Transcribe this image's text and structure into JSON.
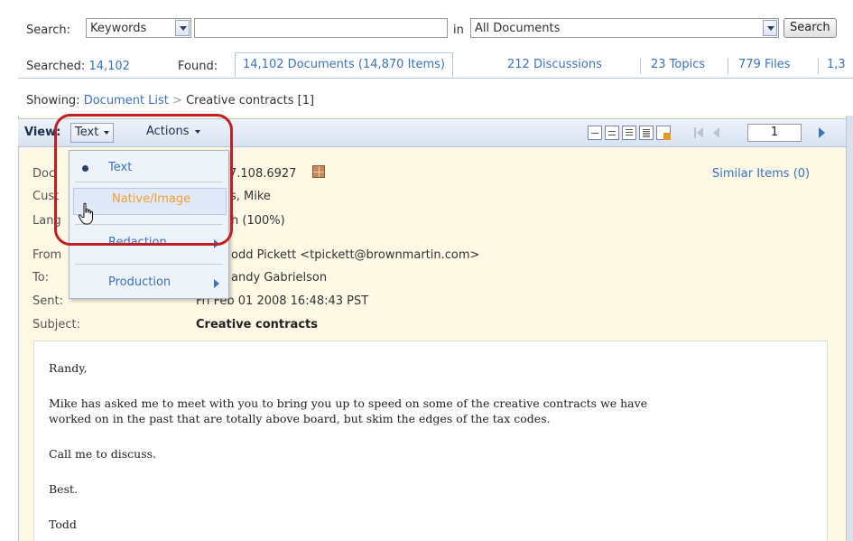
{
  "search": {
    "label": "Search:",
    "field_value": "Keywords",
    "query_value": "",
    "in_label": "in",
    "scope_value": "All Documents",
    "button_label": "Search"
  },
  "counts": {
    "searched_label": "Searched:",
    "searched_value": "14,102",
    "found_label": "Found:"
  },
  "tabs": [
    {
      "label": "14,102 Documents (14,870 Items)",
      "active": true
    },
    {
      "label": "212 Discussions"
    },
    {
      "label": "23 Topics"
    },
    {
      "label": "779 Files"
    },
    {
      "label": "1,3"
    }
  ],
  "breadcrumb": {
    "showing_label": "Showing:",
    "link": "Document List",
    "separator": ">",
    "current": "Creative contracts [1]"
  },
  "toolbar": {
    "view_label": "View:",
    "view_value": "Text",
    "actions_label": "Actions",
    "page_number": "1"
  },
  "view_menu": {
    "items": [
      {
        "label": "Text",
        "selected": true
      },
      {
        "label": "Native/Image",
        "hovered": true
      },
      {
        "label": "Redaction",
        "submenu": true
      },
      {
        "label": "Production",
        "submenu": true
      }
    ]
  },
  "meta": {
    "doc_label": "Doc",
    "doc_value": "7.108.6927",
    "similar_items": "Similar Items (0)",
    "custodian_label": "Cust",
    "custodian_value": "s, Mike",
    "language_label": "Lang",
    "language_value": "h (100%)",
    "from_label": "From",
    "from_value": "odd Pickett <tpickett@brownmartin.com>",
    "to_label": "To:",
    "to_value": "andy Gabrielson",
    "sent_label": "Sent:",
    "sent_value": "Fri Feb 01 2008 16:48:43 PST",
    "subject_label": "Subject:",
    "subject_value": "Creative contracts"
  },
  "body": {
    "greeting": "Randy,",
    "line1": "Mike has asked me to meet with you to bring you up to speed on some of the creative contracts we have",
    "line2": "worked on in the past that are totally above board, but skim the edges of the tax codes.",
    "line3": "Call me to discuss.",
    "closing": "Best.",
    "signature": "Todd"
  },
  "colors": {
    "link": "#3a73c4",
    "panel_bg": "#fdf9e4",
    "highlight_ring": "#c21f24",
    "hover_text": "#f0a030"
  }
}
